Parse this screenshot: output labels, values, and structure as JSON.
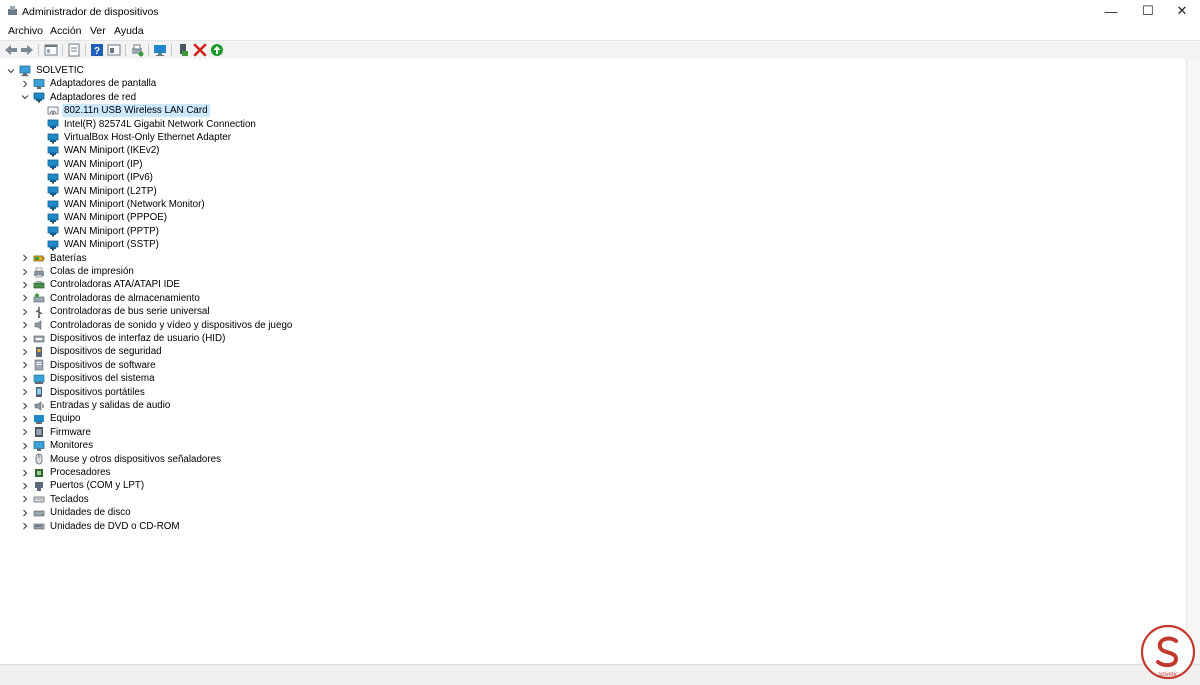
{
  "window": {
    "title": "Administrador de dispositivos"
  },
  "menu": [
    "Archivo",
    "Acción",
    "Ver",
    "Ayuda"
  ],
  "root": {
    "label": "SOLVETIC",
    "icon": "computer-icon"
  },
  "expanded_category": {
    "label": "Adaptadores de red",
    "children": [
      "802.11n USB Wireless LAN Card",
      "Intel(R) 82574L Gigabit Network Connection",
      "VirtualBox Host-Only Ethernet Adapter",
      "WAN Miniport (IKEv2)",
      "WAN Miniport (IP)",
      "WAN Miniport (IPv6)",
      "WAN Miniport (L2TP)",
      "WAN Miniport (Network Monitor)",
      "WAN Miniport (PPPOE)",
      "WAN Miniport (PPTP)",
      "WAN Miniport (SSTP)"
    ],
    "selected_child": "802.11n USB Wireless LAN Card"
  },
  "categories_before": [
    "Adaptadores de pantalla"
  ],
  "categories_after": [
    "Baterías",
    "Colas de impresión",
    "Controladoras ATA/ATAPI IDE",
    "Controladoras de almacenamiento",
    "Controladoras de bus serie universal",
    "Controladoras de sonido y vídeo y dispositivos de juego",
    "Dispositivos de interfaz de usuario (HID)",
    "Dispositivos de seguridad",
    "Dispositivos de software",
    "Dispositivos del sistema",
    "Dispositivos portátiles",
    "Entradas y salidas de audio",
    "Equipo",
    "Firmware",
    "Monitores",
    "Mouse y otros dispositivos señaladores",
    "Procesadores",
    "Puertos (COM y LPT)",
    "Teclados",
    "Unidades de disco",
    "Unidades de DVD o CD-ROM"
  ],
  "colors": {
    "selection": "#cce8ff",
    "network_icon": "#1e88c8",
    "toolbar_bg": "#f3f3f3"
  }
}
